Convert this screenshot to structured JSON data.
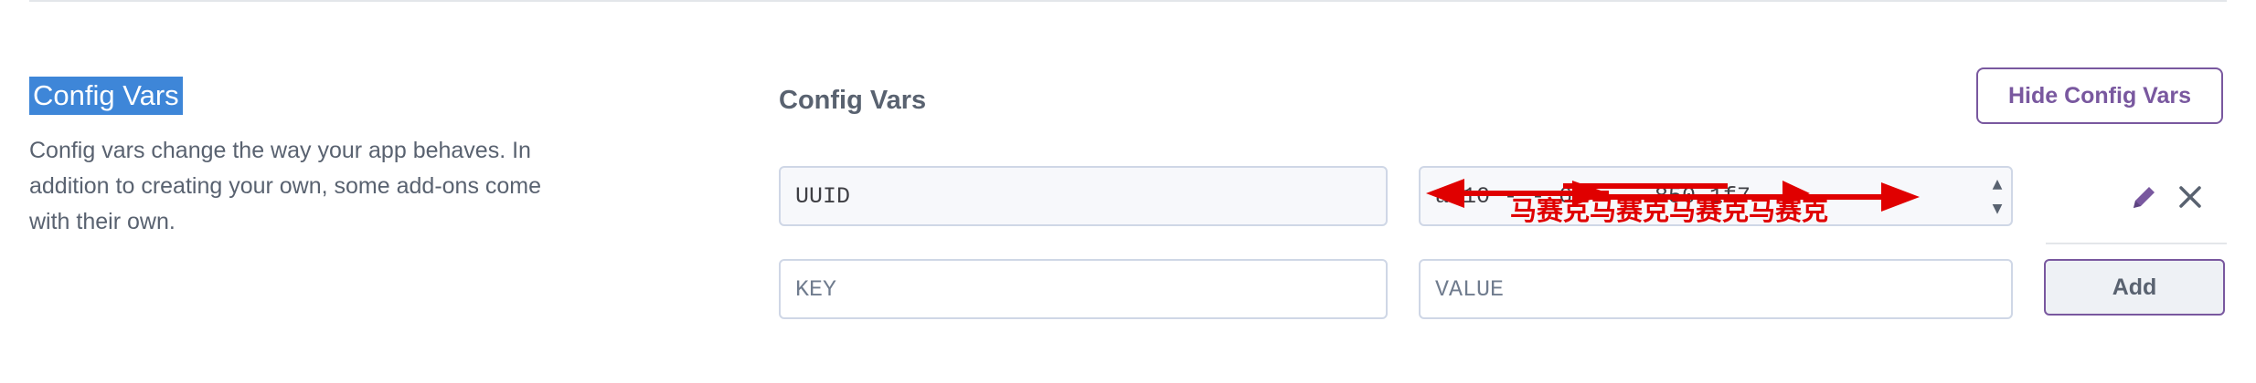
{
  "section": {
    "title": "Config Vars",
    "description": "Config vars change the way your app behaves. In addition to creating your own, some add-ons come with their own."
  },
  "panel": {
    "title": "Config Vars",
    "hide_button": "Hide Config Vars"
  },
  "vars": [
    {
      "key": "UUID",
      "value": "ad10  -    -  63   -    -    850 1f7"
    }
  ],
  "new_var": {
    "key_placeholder": "KEY",
    "value_placeholder": "VALUE",
    "add_label": "Add"
  },
  "annotation": {
    "text": "马赛克马赛克马赛克马赛克",
    "color": "#e00000"
  },
  "icons": {
    "edit": "pencil-icon",
    "delete": "close-icon",
    "spinner_up": "chevron-up-icon",
    "spinner_down": "chevron-down-icon"
  },
  "colors": {
    "accent": "#79589f",
    "selection": "#3e86d8",
    "text_muted": "#596270"
  }
}
